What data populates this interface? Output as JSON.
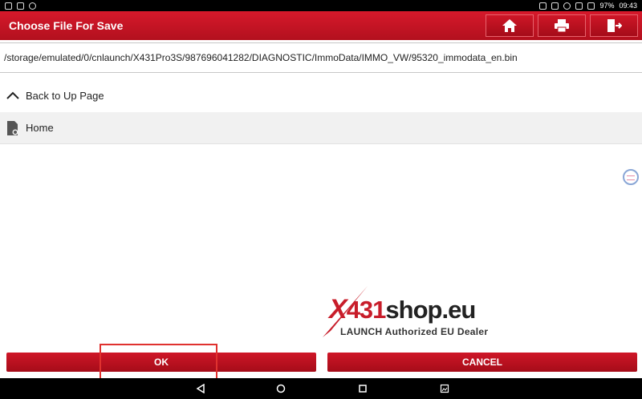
{
  "status_bar": {
    "time": "09:43",
    "battery": "97%"
  },
  "header": {
    "title": "Choose File For Save",
    "buttons": [
      {
        "icon": "home-icon"
      },
      {
        "icon": "printer-icon"
      },
      {
        "icon": "exit-icon"
      }
    ]
  },
  "path": "/storage/emulated/0/cnlaunch/X431Pro3S/987696041282/DIAGNOSTIC/ImmoData/IMMO_VW/95320_immodata_en.bin",
  "file_list": {
    "back_label": "Back to Up Page",
    "items": [
      {
        "label": "Home",
        "icon": "folder-settings-icon"
      }
    ]
  },
  "watermark": {
    "brand_x": "X",
    "brand_num": "431",
    "brand_shop": "shop.eu",
    "tagline": "LAUNCH Authorized EU Dealer"
  },
  "footer": {
    "ok_label": "OK",
    "cancel_label": "CANCEL"
  },
  "colors": {
    "accent": "#c8162a",
    "highlight": "#e0322f"
  }
}
